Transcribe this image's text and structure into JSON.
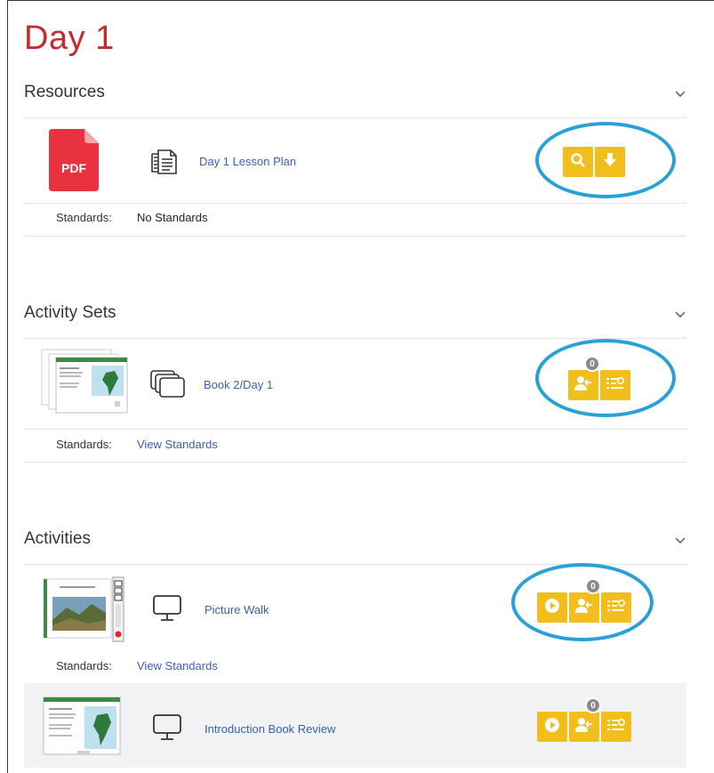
{
  "page": {
    "title": "Day 1"
  },
  "colors": {
    "title_red": "#c62a2f",
    "link_blue": "#3c5fb0",
    "button_yellow": "#f2be1b",
    "highlight_ring": "#2aa0d8"
  },
  "sections": {
    "resources": {
      "title": "Resources",
      "items": [
        {
          "label": "Day 1 Lesson Plan",
          "thumb_text": "PDF",
          "type_icon": "document-stack-icon",
          "standards_label": "Standards:",
          "standards_value": "No Standards",
          "actions": [
            "search-icon",
            "download-icon"
          ]
        }
      ]
    },
    "activity_sets": {
      "title": "Activity Sets",
      "items": [
        {
          "label": "Book 2/Day 1",
          "type_icon": "stacked-screens-icon",
          "standards_label": "Standards:",
          "standards_value": "View Standards",
          "badge": "0",
          "actions": [
            "assign-user-icon",
            "list-settings-icon"
          ]
        }
      ]
    },
    "activities": {
      "title": "Activities",
      "items": [
        {
          "label": "Picture Walk",
          "type_icon": "monitor-icon",
          "standards_label": "Standards:",
          "standards_value": "View Standards",
          "badge": "0",
          "actions": [
            "play-icon",
            "assign-user-icon",
            "list-settings-icon"
          ]
        },
        {
          "label": "Introduction Book Review",
          "type_icon": "monitor-icon",
          "badge": "0",
          "actions": [
            "play-icon",
            "assign-user-icon",
            "list-settings-icon"
          ]
        }
      ]
    }
  }
}
